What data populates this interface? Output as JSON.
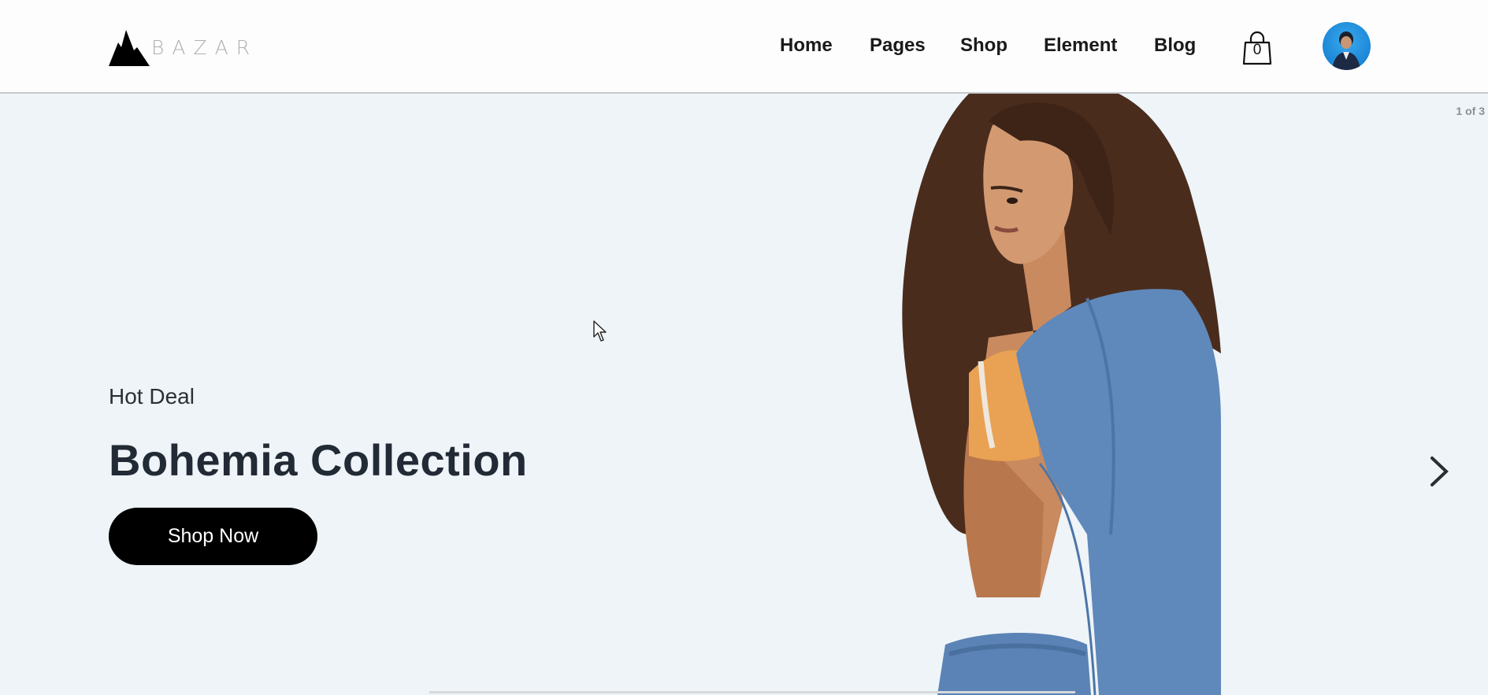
{
  "brand": {
    "name": "BAZAR"
  },
  "nav": {
    "items": [
      {
        "label": "Home"
      },
      {
        "label": "Pages"
      },
      {
        "label": "Shop"
      },
      {
        "label": "Element"
      },
      {
        "label": "Blog"
      }
    ]
  },
  "cart": {
    "count": "0",
    "icon": "shopping-bag-icon"
  },
  "user": {
    "icon": "avatar"
  },
  "hero": {
    "slide_counter": "1 of 3",
    "eyebrow": "Hot Deal",
    "headline": "Bohemia Collection",
    "cta_label": "Shop Now",
    "next_icon": "chevron-right-icon"
  },
  "colors": {
    "hero_bg": "#eef4f8",
    "header_bg": "#fdfdfd",
    "cta_bg": "#000000",
    "cta_text": "#ffffff",
    "headline": "#222a35"
  }
}
